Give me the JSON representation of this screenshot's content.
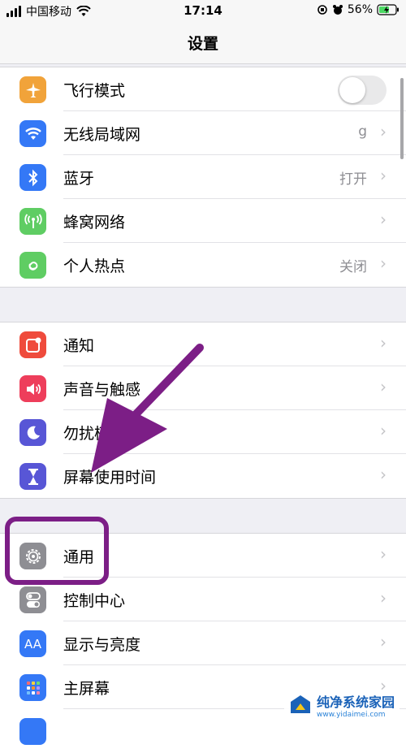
{
  "status_bar": {
    "carrier": "中国移动",
    "time": "17:14",
    "battery": "56%"
  },
  "nav": {
    "title": "设置"
  },
  "groups": [
    {
      "items": [
        {
          "label": "飞行模式",
          "icon": "airplane-icon",
          "color": "#f1a33a",
          "toggle": false
        },
        {
          "label": "无线局域网",
          "icon": "wifi-icon",
          "color": "#3478f6",
          "value": "g"
        },
        {
          "label": "蓝牙",
          "icon": "bluetooth-icon",
          "color": "#3478f6",
          "value": "打开"
        },
        {
          "label": "蜂窝网络",
          "icon": "cellular-icon",
          "color": "#5fcd63",
          "value": ""
        },
        {
          "label": "个人热点",
          "icon": "hotspot-icon",
          "color": "#5fcd63",
          "value": "关闭"
        }
      ]
    },
    {
      "items": [
        {
          "label": "通知",
          "icon": "notifications-icon",
          "color": "#ef4b3c"
        },
        {
          "label": "声音与触感",
          "icon": "sound-icon",
          "color": "#ee3e5b"
        },
        {
          "label": "勿扰模式",
          "icon": "moon-icon",
          "color": "#5856d6"
        },
        {
          "label": "屏幕使用时间",
          "icon": "hourglass-icon",
          "color": "#5856d6"
        }
      ]
    },
    {
      "items": [
        {
          "label": "通用",
          "icon": "gear-icon",
          "color": "#8e8e93"
        },
        {
          "label": "控制中心",
          "icon": "switches-icon",
          "color": "#8e8e93"
        },
        {
          "label": "显示与亮度",
          "icon": "text-size-icon",
          "color": "#3478f6",
          "icon_text": "AA"
        },
        {
          "label": "主屏幕",
          "icon": "home-grid-icon",
          "color": "#3478f6"
        }
      ]
    }
  ],
  "annotation": {
    "color": "#7c1e86"
  },
  "watermark": {
    "brand": "纯净系统家园",
    "url": "www.yidaimei.com"
  }
}
